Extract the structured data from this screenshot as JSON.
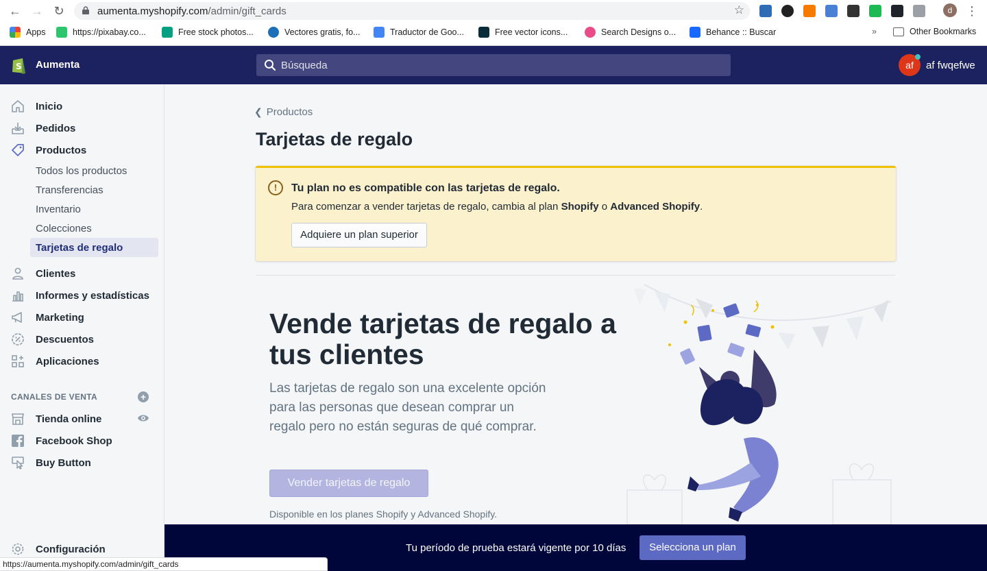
{
  "browser": {
    "url_host": "aumenta.myshopify.com",
    "url_path": "/admin/gift_cards",
    "bookmarks": [
      {
        "label": "Apps"
      },
      {
        "label": "https://pixabay.co..."
      },
      {
        "label": "Free stock photos..."
      },
      {
        "label": "Vectores gratis, fo..."
      },
      {
        "label": "Traductor de Goo..."
      },
      {
        "label": "Free vector icons..."
      },
      {
        "label": "Search Designs o..."
      },
      {
        "label": "Behance :: Buscar"
      }
    ],
    "other_bookmarks": "Other Bookmarks",
    "overflow": "»",
    "profile_initial": "d",
    "status_url": "https://aumenta.myshopify.com/admin/gift_cards"
  },
  "topbar": {
    "store_name": "Aumenta",
    "search_placeholder": "Búsqueda",
    "avatar_initials": "af",
    "user_name": "af fwqefwe"
  },
  "sidebar": {
    "items": [
      {
        "label": "Inicio",
        "icon": "home-icon"
      },
      {
        "label": "Pedidos",
        "icon": "orders-icon"
      },
      {
        "label": "Productos",
        "icon": "tag-icon"
      }
    ],
    "product_subitems": [
      {
        "label": "Todos los productos"
      },
      {
        "label": "Transferencias"
      },
      {
        "label": "Inventario"
      },
      {
        "label": "Colecciones"
      },
      {
        "label": "Tarjetas de regalo"
      }
    ],
    "items2": [
      {
        "label": "Clientes",
        "icon": "customer-icon"
      },
      {
        "label": "Informes y estadísticas",
        "icon": "analytics-icon"
      },
      {
        "label": "Marketing",
        "icon": "megaphone-icon"
      },
      {
        "label": "Descuentos",
        "icon": "discount-icon"
      },
      {
        "label": "Aplicaciones",
        "icon": "apps-icon"
      }
    ],
    "channels_heading": "CANALES DE VENTA",
    "channels": [
      {
        "label": "Tienda online",
        "icon": "store-icon"
      },
      {
        "label": "Facebook Shop",
        "icon": "facebook-icon"
      },
      {
        "label": "Buy Button",
        "icon": "buy-button-icon"
      }
    ],
    "settings_label": "Configuración"
  },
  "main": {
    "breadcrumb": "Productos",
    "title": "Tarjetas de regalo",
    "banner": {
      "title": "Tu plan no es compatible con las tarjetas de regalo.",
      "text_prefix": "Para comenzar a vender tarjetas de regalo, cambia al plan ",
      "plan1": "Shopify",
      "text_mid": " o ",
      "plan2": "Advanced Shopify",
      "text_suffix": ".",
      "button": "Adquiere un plan superior"
    },
    "hero": {
      "title": "Vende tarjetas de regalo a tus clientes",
      "text": "Las tarjetas de regalo son una excelente opción para las personas que desean comprar un regalo pero no están seguras de qué comprar.",
      "button": "Vender tarjetas de regalo",
      "note": "Disponible en los planes Shopify y Advanced Shopify."
    }
  },
  "trial": {
    "text": "Tu período de prueba estará vigente por 10 días",
    "button": "Selecciona un plan"
  },
  "colors": {
    "topbar": "#1c2260",
    "accent": "#5c6ac4",
    "banner_bg": "#fcf1cd",
    "banner_border": "#eec200",
    "trial_bar": "#000639"
  }
}
